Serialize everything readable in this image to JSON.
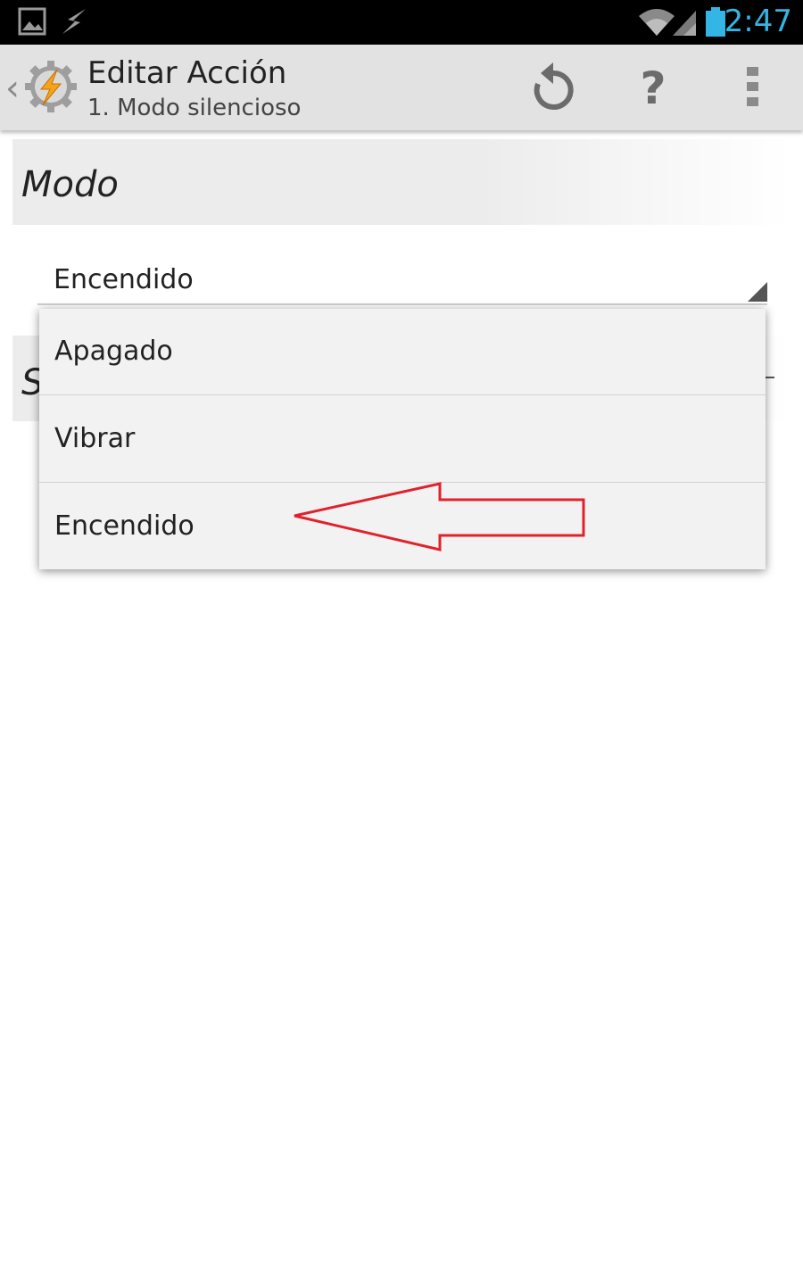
{
  "status_bar": {
    "time": "2:47",
    "left_icons": [
      "picture-icon",
      "flash-icon"
    ],
    "right_icons": [
      "wifi-icon",
      "signal-icon",
      "battery-icon"
    ],
    "accent_color": "#33b5e5"
  },
  "action_bar": {
    "title": "Editar Acción",
    "subtitle": "1. Modo silencioso",
    "help_label": "?",
    "icons": [
      "tasker-app-icon",
      "undo-icon",
      "help-icon",
      "overflow-menu-icon"
    ]
  },
  "form": {
    "section_label": "Modo",
    "second_section_label": "S",
    "spinner_value": "Encendido"
  },
  "dropdown": {
    "options": [
      {
        "label": "Apagado"
      },
      {
        "label": "Vibrar"
      },
      {
        "label": "Encendido"
      }
    ],
    "highlighted_option": "Encendido",
    "annotation_color": "#e0222c"
  }
}
